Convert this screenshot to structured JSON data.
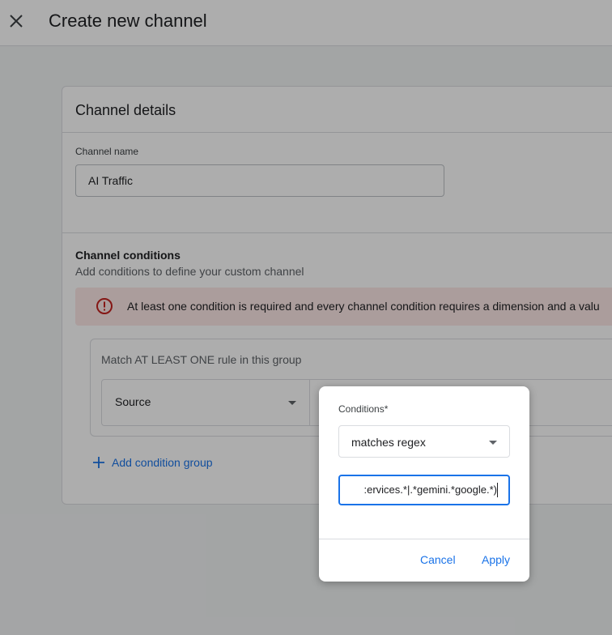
{
  "header": {
    "title": "Create new channel",
    "close_icon": "close-icon"
  },
  "channel_details": {
    "title": "Channel details",
    "name_label": "Channel name",
    "name_value": "AI Traffic"
  },
  "channel_conditions": {
    "title": "Channel conditions",
    "subtitle": "Add conditions to define your custom channel",
    "error_message": "At least one condition is required and every channel condition requires a dimension and a valu",
    "error_icon": "error-icon",
    "group": {
      "label": "Match AT LEAST ONE rule in this group",
      "dimension": "Source"
    },
    "add_group_label": "Add condition group",
    "add_icon": "plus-icon"
  },
  "popup": {
    "conditions_label": "Conditions*",
    "selected_condition": "matches regex",
    "regex_value": ":ervices.*|.*gemini.*google.*)",
    "cancel_label": "Cancel",
    "apply_label": "Apply"
  },
  "colors": {
    "accent": "#1a73e8",
    "error_bg": "#fce8e6",
    "error_icon": "#c5221f"
  }
}
